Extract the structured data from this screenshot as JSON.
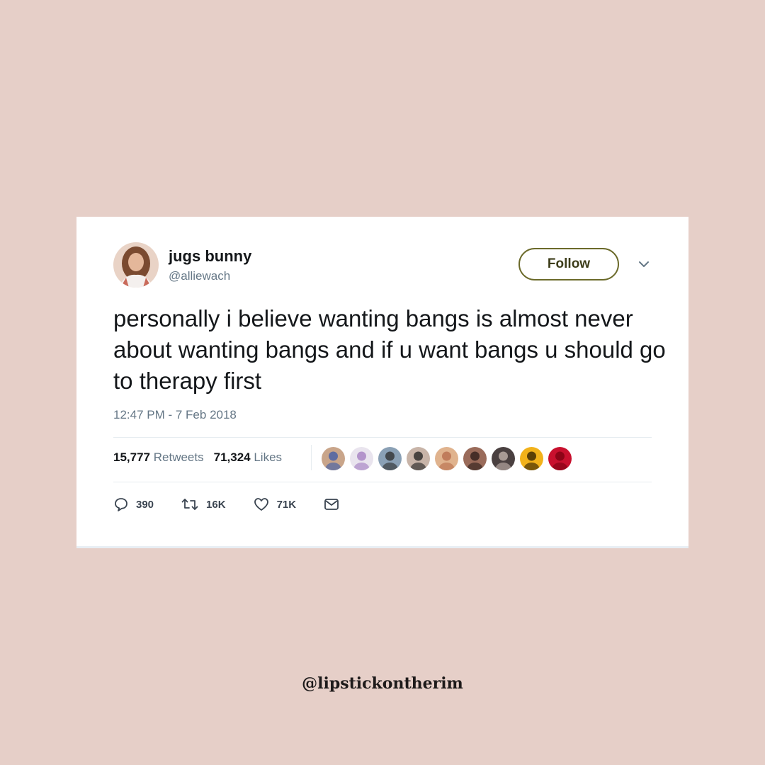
{
  "tweet": {
    "display_name": "jugs bunny",
    "handle": "@alliewach",
    "follow_label": "Follow",
    "text": "personally i believe wanting bangs is almost never about wanting bangs and if u want bangs u should go to therapy first",
    "timestamp": "12:47 PM - 7 Feb 2018",
    "retweets_count": "15,777",
    "retweets_label": "Retweets",
    "likes_count": "71,324",
    "likes_label": "Likes",
    "actions": {
      "reply_count": "390",
      "retweet_count": "16K",
      "like_count": "71K"
    },
    "liker_faces": [
      {
        "color": "#c9a58a",
        "accent": "#3b5aa8"
      },
      {
        "color": "#e9e4ee",
        "accent": "#a07abf"
      },
      {
        "color": "#8aa0b5",
        "accent": "#2b2b2b"
      },
      {
        "color": "#c8b4a8",
        "accent": "#1e1e1e"
      },
      {
        "color": "#e0b38e",
        "accent": "#b56a4a"
      },
      {
        "color": "#9a6b5a",
        "accent": "#2a1a18"
      },
      {
        "color": "#4a4040",
        "accent": "#c8b8b0"
      },
      {
        "color": "#f2b21a",
        "accent": "#2a1a00"
      },
      {
        "color": "#c8102e",
        "accent": "#7a0010"
      }
    ]
  },
  "watermark": "@lipstickontherim",
  "colors": {
    "background": "#e6cfc8",
    "card": "#ffffff",
    "follow_border": "#6b6a2a",
    "secondary_text": "#657786"
  },
  "icons": [
    "reply-icon",
    "retweet-icon",
    "like-icon",
    "dm-icon",
    "chevron-down-icon"
  ]
}
